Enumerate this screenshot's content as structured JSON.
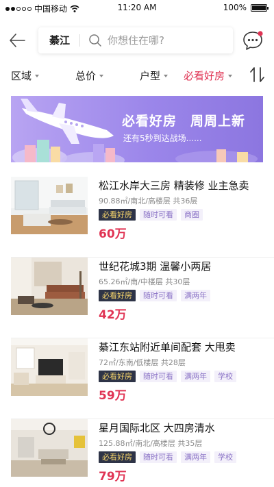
{
  "status_bar": {
    "carrier": "中国移动",
    "time": "11:20 AM",
    "battery": "100%",
    "battery_level": 1.0
  },
  "header": {
    "city": "綦江",
    "search_placeholder": "你想住在哪?",
    "back_icon": "arrow-left-icon",
    "message_icon": "chat-bubble-icon",
    "unread_dot_color": "#e03454"
  },
  "filters": {
    "items": [
      "区域",
      "总价",
      "户型",
      "必看好房"
    ],
    "active_index": 3,
    "active_color": "#e03454",
    "sort_icon": "sort-arrows-icon"
  },
  "banner": {
    "title": "必看好房　周周上新",
    "subtitle": "还有5秒到达战场......"
  },
  "listings": [
    {
      "title": "松江水岸大三房 精装修 业主急卖",
      "meta": "90.88㎡/南北/高楼层 共36层",
      "tags": [
        "必看好房",
        "随时可看",
        "商圈"
      ],
      "price": "60万"
    },
    {
      "title": "世纪花城3期 温馨小两居",
      "meta": "65.26㎡/南/中楼层 共30层",
      "tags": [
        "必看好房",
        "随时可看",
        "满两年"
      ],
      "price": "42万"
    },
    {
      "title": "綦江东站附近单间配套 大甩卖",
      "meta": "72㎡/东南/低楼层 共28层",
      "tags": [
        "必看好房",
        "随时可看",
        "满两年",
        "学校"
      ],
      "price": "59万"
    },
    {
      "title": "星月国际北区 大四房清水",
      "meta": "125.88㎡/南北/高楼层 共35层",
      "tags": [
        "必看好房",
        "随时可看",
        "满两年",
        "学校"
      ],
      "price": "79万"
    }
  ],
  "colors": {
    "accent": "#e03454",
    "tag_dark_bg": "#2e3447",
    "tag_dark_text": "#f7d56b",
    "tag_light_bg": "#f3f0fa",
    "tag_light_text": "#8a72c6",
    "banner": "#9b86ea"
  }
}
